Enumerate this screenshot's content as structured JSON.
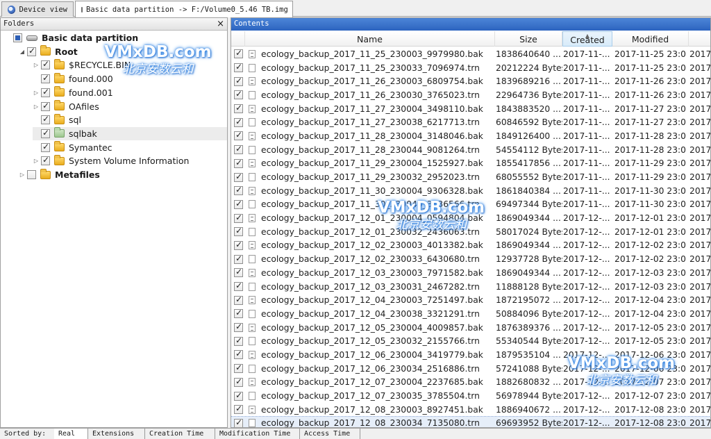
{
  "top_tabs": [
    {
      "label": "Device view",
      "icon": "device-icon"
    },
    {
      "label": "Basic data partition -> F:/Volume0_5.46 TB.img",
      "icon": "disk-icon"
    }
  ],
  "folders": {
    "title": "Folders",
    "close": "×",
    "tree": [
      {
        "label": "Basic data partition",
        "bold": true,
        "check": "partial",
        "icon": "hdd"
      },
      {
        "label": "Root",
        "bold": true,
        "check": "on",
        "icon": "folder",
        "expander": "◢"
      },
      {
        "label": "$RECYCLE.BIN",
        "check": "on",
        "icon": "folder",
        "expander": "▷"
      },
      {
        "label": "found.000",
        "check": "on",
        "icon": "folder"
      },
      {
        "label": "found.001",
        "check": "on",
        "icon": "folder",
        "expander": "▷"
      },
      {
        "label": "OAfiles",
        "check": "on",
        "icon": "folder",
        "expander": "▷"
      },
      {
        "label": "sql",
        "check": "on",
        "icon": "folder"
      },
      {
        "label": "sqlbak",
        "check": "on",
        "icon": "folder-green",
        "selected": true
      },
      {
        "label": "Symantec",
        "check": "on",
        "icon": "folder"
      },
      {
        "label": "System Volume Information",
        "check": "on",
        "icon": "folder",
        "expander": "▷"
      },
      {
        "label": "Metafiles",
        "bold": true,
        "check": "off",
        "icon": "folder",
        "expander": "▷"
      }
    ]
  },
  "contents": {
    "title": "Contents",
    "columns": {
      "name": "Name",
      "size": "Size",
      "created": "Created",
      "modified": "Modified"
    },
    "rows": [
      {
        "name": "ecology_backup_2017_11_25_230003_9979980.bak",
        "size": "1838640640 ...",
        "created": "2017-11-...",
        "modified": "2017-11-25 23:0...",
        "extra": "2017-"
      },
      {
        "name": "ecology_backup_2017_11_25_230033_7096974.trn",
        "size": "20212224 Bytes",
        "created": "2017-11-...",
        "modified": "2017-11-25 23:0...",
        "extra": "2017-"
      },
      {
        "name": "ecology_backup_2017_11_26_230003_6809754.bak",
        "size": "1839689216 ...",
        "created": "2017-11-...",
        "modified": "2017-11-26 23:0...",
        "extra": "2017-"
      },
      {
        "name": "ecology_backup_2017_11_26_230030_3765023.trn",
        "size": "22964736 Bytes",
        "created": "2017-11-...",
        "modified": "2017-11-26 23:0...",
        "extra": "2017-"
      },
      {
        "name": "ecology_backup_2017_11_27_230004_3498110.bak",
        "size": "1843883520 ...",
        "created": "2017-11-...",
        "modified": "2017-11-27 23:0...",
        "extra": "2017-"
      },
      {
        "name": "ecology_backup_2017_11_27_230038_6217713.trn",
        "size": "60846592 Bytes",
        "created": "2017-11-...",
        "modified": "2017-11-27 23:0...",
        "extra": "2017-"
      },
      {
        "name": "ecology_backup_2017_11_28_230004_3148046.bak",
        "size": "1849126400 ...",
        "created": "2017-11-...",
        "modified": "2017-11-28 23:0...",
        "extra": "2017-"
      },
      {
        "name": "ecology_backup_2017_11_28_230044_9081264.trn",
        "size": "54554112 Bytes",
        "created": "2017-11-...",
        "modified": "2017-11-28 23:0...",
        "extra": "2017-"
      },
      {
        "name": "ecology_backup_2017_11_29_230004_1525927.bak",
        "size": "1855417856 ...",
        "created": "2017-11-...",
        "modified": "2017-11-29 23:0...",
        "extra": "2017-"
      },
      {
        "name": "ecology_backup_2017_11_29_230032_2952023.trn",
        "size": "68055552 Bytes",
        "created": "2017-11-...",
        "modified": "2017-11-29 23:0...",
        "extra": "2017-"
      },
      {
        "name": "ecology_backup_2017_11_30_230004_9306328.bak",
        "size": "1861840384 ...",
        "created": "2017-11-...",
        "modified": "2017-11-30 23:0...",
        "extra": "2017-"
      },
      {
        "name": "ecology_backup_2017_11_30_230040_3136566.trn",
        "size": "69497344 Bytes",
        "created": "2017-11-...",
        "modified": "2017-11-30 23:0...",
        "extra": "2017-"
      },
      {
        "name": "ecology_backup_2017_12_01_230004_0594804.bak",
        "size": "1869049344 ...",
        "created": "2017-12-...",
        "modified": "2017-12-01 23:0...",
        "extra": "2017-"
      },
      {
        "name": "ecology_backup_2017_12_01_230032_2436063.trn",
        "size": "58017024 Bytes",
        "created": "2017-12-...",
        "modified": "2017-12-01 23:0...",
        "extra": "2017-"
      },
      {
        "name": "ecology_backup_2017_12_02_230003_4013382.bak",
        "size": "1869049344 ...",
        "created": "2017-12-...",
        "modified": "2017-12-02 23:0...",
        "extra": "2017-"
      },
      {
        "name": "ecology_backup_2017_12_02_230033_6430680.trn",
        "size": "12937728 Bytes",
        "created": "2017-12-...",
        "modified": "2017-12-02 23:0...",
        "extra": "2017-"
      },
      {
        "name": "ecology_backup_2017_12_03_230003_7971582.bak",
        "size": "1869049344 ...",
        "created": "2017-12-...",
        "modified": "2017-12-03 23:0...",
        "extra": "2017-"
      },
      {
        "name": "ecology_backup_2017_12_03_230031_2467282.trn",
        "size": "11888128 Bytes",
        "created": "2017-12-...",
        "modified": "2017-12-03 23:0...",
        "extra": "2017-"
      },
      {
        "name": "ecology_backup_2017_12_04_230003_7251497.bak",
        "size": "1872195072 ...",
        "created": "2017-12-...",
        "modified": "2017-12-04 23:0...",
        "extra": "2017-"
      },
      {
        "name": "ecology_backup_2017_12_04_230038_3321291.trn",
        "size": "50884096 Bytes",
        "created": "2017-12-...",
        "modified": "2017-12-04 23:0...",
        "extra": "2017-"
      },
      {
        "name": "ecology_backup_2017_12_05_230004_4009857.bak",
        "size": "1876389376 ...",
        "created": "2017-12-...",
        "modified": "2017-12-05 23:0...",
        "extra": "2017-"
      },
      {
        "name": "ecology_backup_2017_12_05_230032_2155766.trn",
        "size": "55340544 Bytes",
        "created": "2017-12-...",
        "modified": "2017-12-05 23:0...",
        "extra": "2017-"
      },
      {
        "name": "ecology_backup_2017_12_06_230004_3419779.bak",
        "size": "1879535104 ...",
        "created": "2017-12-...",
        "modified": "2017-12-06 23:0...",
        "extra": "2017-"
      },
      {
        "name": "ecology_backup_2017_12_06_230034_2516886.trn",
        "size": "57241088 Bytes",
        "created": "2017-12-...",
        "modified": "2017-12-06 23:0...",
        "extra": "2017-"
      },
      {
        "name": "ecology_backup_2017_12_07_230004_2237685.bak",
        "size": "1882680832 ...",
        "created": "2017-12-...",
        "modified": "2017-12-07 23:0...",
        "extra": "2017-"
      },
      {
        "name": "ecology_backup_2017_12_07_230035_3785504.trn",
        "size": "56978944 Bytes",
        "created": "2017-12-...",
        "modified": "2017-12-07 23:0...",
        "extra": "2017-"
      },
      {
        "name": "ecology_backup_2017_12_08_230003_8927451.bak",
        "size": "1886940672 ...",
        "created": "2017-12-...",
        "modified": "2017-12-08 23:0...",
        "extra": "2017-"
      },
      {
        "name": "ecology_backup_2017_12_08_230034_7135080.trn",
        "size": "69693952 Bytes",
        "created": "2017-12-...",
        "modified": "2017-12-08 23:0...",
        "extra": "2017-",
        "selected": true
      }
    ]
  },
  "bottom_bar": {
    "label": "Sorted by:",
    "tabs": [
      "Real",
      "Extensions",
      "Creation Time",
      "Modification Time",
      "Access Time"
    ],
    "active": "Real"
  },
  "watermark": {
    "line1": "VMxDB.com",
    "line2": "北京安数云和"
  },
  "colors": {
    "contents_header": "#2c63bf",
    "folder": "#f0c24a",
    "selection": "#e6eef9"
  }
}
